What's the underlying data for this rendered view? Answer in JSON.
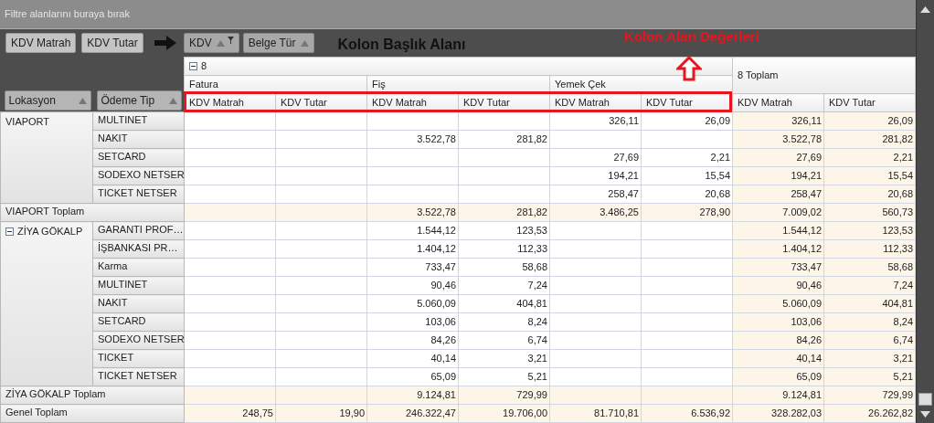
{
  "filter_area": {
    "placeholder": "Filtre alanlarını buraya bırak"
  },
  "data_fields": [
    {
      "label": "KDV Matrah"
    },
    {
      "label": "KDV Tutar"
    }
  ],
  "column_fields": [
    {
      "label": "KDV",
      "filtered": true
    },
    {
      "label": "Belge Tür",
      "filtered": false
    }
  ],
  "column_header_note": "Kolon Başlık Alanı",
  "column_values_note": "Kolon Alan Değerleri",
  "row_fields": [
    {
      "label": "Lokasyon"
    },
    {
      "label": "Ödeme Tip"
    }
  ],
  "column_header": {
    "group": {
      "label": "8",
      "expanded": true
    },
    "types": [
      "Fatura",
      "Fiş",
      "Yemek Çek"
    ],
    "total_label": "8 Toplam",
    "measures": [
      "KDV Matrah",
      "KDV Tutar",
      "KDV Matrah",
      "KDV Tutar",
      "KDV Matrah",
      "KDV Tutar",
      "KDV Matrah",
      "KDV Tutar"
    ]
  },
  "row_groups": [
    {
      "label": "VIAPORT",
      "rows": [
        {
          "label": "MULTINET",
          "cells": {
            "yemek_cek_matrah": "326,11",
            "yemek_cek_tutar": "26,09",
            "total_matrah": "326,11",
            "total_tutar": "26,09"
          }
        },
        {
          "label": "NAKIT",
          "cells": {
            "fis_matrah": "3.522,78",
            "fis_tutar": "281,82",
            "total_matrah": "3.522,78",
            "total_tutar": "281,82"
          }
        },
        {
          "label": "SETCARD",
          "cells": {
            "yemek_cek_matrah": "27,69",
            "yemek_cek_tutar": "2,21",
            "total_matrah": "27,69",
            "total_tutar": "2,21"
          }
        },
        {
          "label": "SODEXO NETSER",
          "cells": {
            "yemek_cek_matrah": "194,21",
            "yemek_cek_tutar": "15,54",
            "total_matrah": "194,21",
            "total_tutar": "15,54"
          }
        },
        {
          "label": "TICKET NETSER",
          "cells": {
            "yemek_cek_matrah": "258,47",
            "yemek_cek_tutar": "20,68",
            "total_matrah": "258,47",
            "total_tutar": "20,68"
          }
        }
      ],
      "total": {
        "label": "VIAPORT Toplam",
        "cells": {
          "fis_matrah": "3.522,78",
          "fis_tutar": "281,82",
          "yemek_cek_matrah": "3.486,25",
          "yemek_cek_tutar": "278,90",
          "total_matrah": "7.009,02",
          "total_tutar": "560,73"
        }
      }
    },
    {
      "label": "ZİYA GÖKALP",
      "expanded": true,
      "rows": [
        {
          "label": "GARANTI PROF…",
          "cells": {
            "fis_matrah": "1.544,12",
            "fis_tutar": "123,53",
            "total_matrah": "1.544,12",
            "total_tutar": "123,53"
          }
        },
        {
          "label": "İŞBANKASI PR…",
          "cells": {
            "fis_matrah": "1.404,12",
            "fis_tutar": "112,33",
            "total_matrah": "1.404,12",
            "total_tutar": "112,33"
          }
        },
        {
          "label": "Karma",
          "cells": {
            "fis_matrah": "733,47",
            "fis_tutar": "58,68",
            "total_matrah": "733,47",
            "total_tutar": "58,68"
          }
        },
        {
          "label": "MULTINET",
          "cells": {
            "fis_matrah": "90,46",
            "fis_tutar": "7,24",
            "total_matrah": "90,46",
            "total_tutar": "7,24"
          }
        },
        {
          "label": "NAKIT",
          "cells": {
            "fis_matrah": "5.060,09",
            "fis_tutar": "404,81",
            "total_matrah": "5.060,09",
            "total_tutar": "404,81"
          }
        },
        {
          "label": "SETCARD",
          "cells": {
            "fis_matrah": "103,06",
            "fis_tutar": "8,24",
            "total_matrah": "103,06",
            "total_tutar": "8,24"
          }
        },
        {
          "label": "SODEXO NETSER",
          "cells": {
            "fis_matrah": "84,26",
            "fis_tutar": "6,74",
            "total_matrah": "84,26",
            "total_tutar": "6,74"
          }
        },
        {
          "label": "TICKET",
          "cells": {
            "fis_matrah": "40,14",
            "fis_tutar": "3,21",
            "total_matrah": "40,14",
            "total_tutar": "3,21"
          }
        },
        {
          "label": "TICKET NETSER",
          "cells": {
            "fis_matrah": "65,09",
            "fis_tutar": "5,21",
            "total_matrah": "65,09",
            "total_tutar": "5,21"
          }
        }
      ],
      "total": {
        "label": "ZİYA GÖKALP Toplam",
        "cells": {
          "fis_matrah": "9.124,81",
          "fis_tutar": "729,99",
          "total_matrah": "9.124,81",
          "total_tutar": "729,99"
        }
      }
    }
  ],
  "grand_total": {
    "label": "Genel Toplam",
    "cells": {
      "fatura_matrah": "248,75",
      "fatura_tutar": "19,90",
      "fis_matrah": "246.322,47",
      "fis_tutar": "19.706,00",
      "yemek_cek_matrah": "81.710,81",
      "yemek_cek_tutar": "6.536,92",
      "total_matrah": "328.282,03",
      "total_tutar": "26.262,82"
    }
  }
}
